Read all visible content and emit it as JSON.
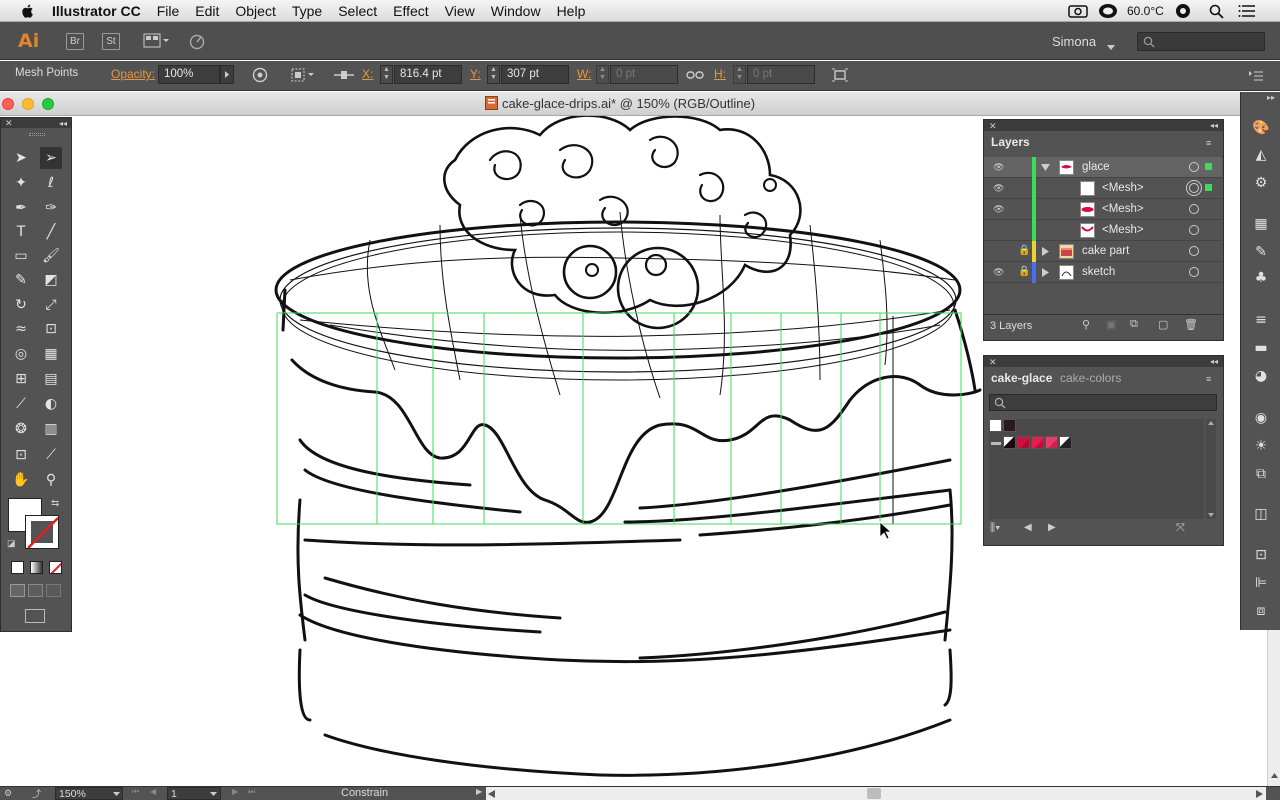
{
  "menubar": {
    "app_name": "Illustrator CC",
    "items": [
      "File",
      "Edit",
      "Object",
      "Type",
      "Select",
      "Effect",
      "View",
      "Window",
      "Help"
    ],
    "temperature": "60.0°C"
  },
  "appbar": {
    "logo": "Ai",
    "bridge": "Br",
    "stock": "St",
    "user": "Simona"
  },
  "control": {
    "selection": "Mesh Points",
    "opacity_label": "Opacity:",
    "opacity_value": "100%",
    "x_label": "X:",
    "x_value": "816.4 pt",
    "y_label": "Y:",
    "y_value": "307 pt",
    "w_label": "W:",
    "w_value": "0 pt",
    "h_label": "H:",
    "h_value": "0 pt"
  },
  "document": {
    "title": "cake-glace-drips.ai* @ 150% (RGB/Outline)"
  },
  "layers_panel": {
    "title": "Layers",
    "rows": [
      {
        "name": "glace"
      },
      {
        "name": "<Mesh>"
      },
      {
        "name": "<Mesh>"
      },
      {
        "name": "<Mesh>"
      },
      {
        "name": "cake part"
      },
      {
        "name": "sketch"
      }
    ],
    "count": "3 Layers"
  },
  "swatches_panel": {
    "tab_active": "cake-glace",
    "tab_inactive": "cake-colors"
  },
  "status": {
    "zoom": "150%",
    "page": "1",
    "mode": "Constrain"
  },
  "colors": {
    "accent_orange": "#e7953c",
    "mesh_green": "#3ddc57",
    "swatch_red": "#d0103c",
    "swatch_pink": "#e83c6b"
  }
}
